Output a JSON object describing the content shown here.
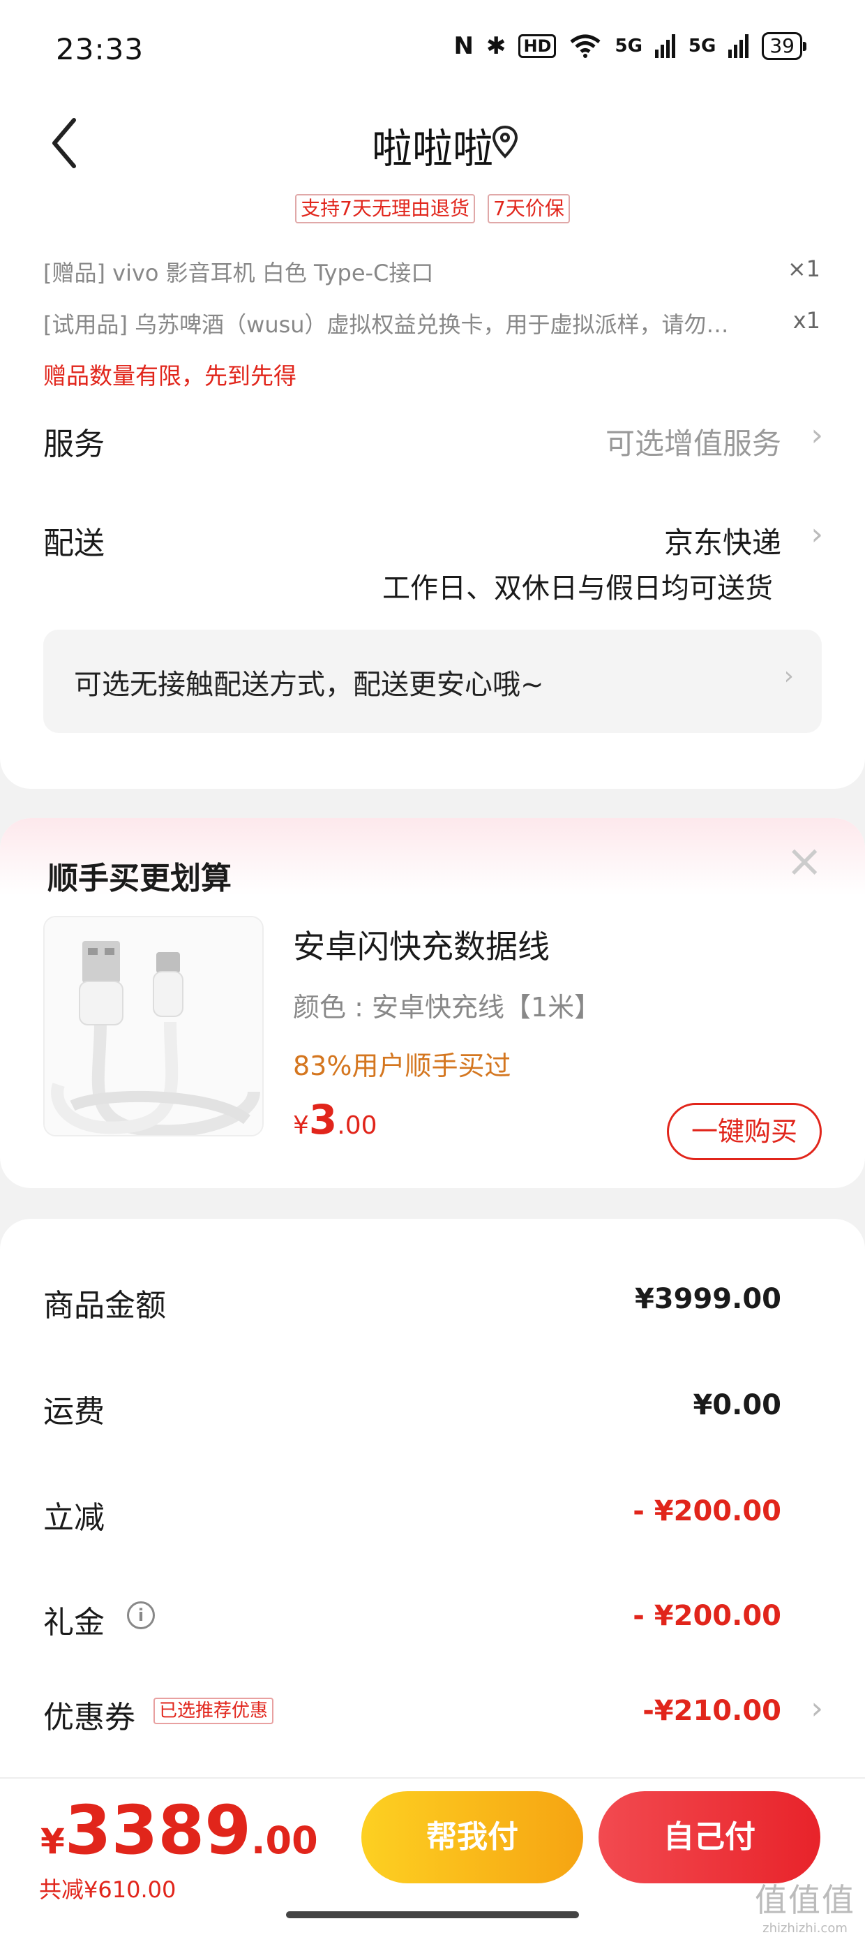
{
  "status_bar": {
    "time": "23:33",
    "nfc": "N",
    "bluetooth": "✱",
    "hd": "HD",
    "signal1": "5G",
    "signal2": "5G",
    "battery": "39"
  },
  "header": {
    "title": "啦啦啦"
  },
  "guarantee_tags": [
    "支持7天无理由退货",
    "7天价保"
  ],
  "gifts": [
    {
      "text": "[赠品] vivo 影音耳机 白色 Type-C接口",
      "qty": "×1"
    },
    {
      "text": "[试用品] 乌苏啤酒（wusu）虚拟权益兑换卡，用于虚拟派样，请勿…",
      "qty": "x1"
    }
  ],
  "gift_limit": "赠品数量有限，先到先得",
  "service": {
    "label": "服务",
    "value": "可选增值服务"
  },
  "delivery": {
    "label": "配送",
    "value": "京东快递",
    "sub": "工作日、双休日与假日均可送货"
  },
  "contactless": "可选无接触配送方式，配送更安心哦~",
  "upsell": {
    "title": "顺手买更划算",
    "product_name": "安卓闪快充数据线",
    "spec": "颜色 : 安卓快充线【1米】",
    "hint": "83%用户顺手买过",
    "price_symbol": "¥",
    "price_int": "3",
    "price_dec": ".00",
    "buy_label": "一键购买"
  },
  "summary": [
    {
      "label": "商品金额",
      "value": "¥3999.00"
    },
    {
      "label": "运费",
      "value": "¥0.00"
    },
    {
      "label": "立减",
      "value": "- ¥200.00"
    },
    {
      "label": "礼金",
      "value": "- ¥200.00"
    },
    {
      "label": "优惠券",
      "badge": "已选推荐优惠",
      "value": "-¥210.00"
    }
  ],
  "bottom": {
    "total_symbol": "¥",
    "total_int": "3389",
    "total_dec": ".00",
    "total_saved": "共减¥610.00",
    "help_pay": "帮我付",
    "self_pay": "自己付"
  },
  "watermark": {
    "big": "值值值",
    "small": "zhizhizhi.com"
  },
  "colors": {
    "accent_red": "#e1251b",
    "help_pay_yellow": "#f6a412",
    "upsell_orange": "#d4761f"
  }
}
